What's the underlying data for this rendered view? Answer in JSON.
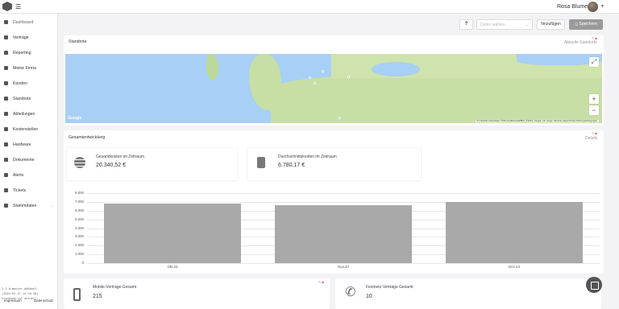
{
  "header": {
    "username": "Rosa Blume",
    "menu_icon": "hamburger-icon",
    "logo_icon": "app-logo"
  },
  "sidebar": {
    "items": [
      {
        "label": "Dashboard",
        "icon": "dashboard-icon"
      },
      {
        "label": "Verträge",
        "icon": "contract-icon"
      },
      {
        "label": "Reporting",
        "icon": "chart-icon"
      },
      {
        "label": "Meine Firma",
        "icon": "home-icon"
      },
      {
        "label": "Kunden",
        "icon": "customers-icon"
      },
      {
        "label": "Standorte",
        "icon": "location-icon"
      },
      {
        "label": "Abteilungen",
        "icon": "departments-icon"
      },
      {
        "label": "Kostenstellen",
        "icon": "cost-centers-icon"
      },
      {
        "label": "Hardware",
        "icon": "hardware-icon"
      },
      {
        "label": "Dokumente",
        "icon": "document-icon"
      },
      {
        "label": "Alerts",
        "icon": "alert-icon"
      },
      {
        "label": "Tickets",
        "icon": "ticket-icon"
      },
      {
        "label": "Stammdaten",
        "icon": "master-data-icon"
      }
    ],
    "version_lines": [
      "2.1.0-master-d66da4f",
      "(2024-02-21 14:34:30)",
      "Frontend ist aktuell"
    ],
    "footer_links": [
      "Impressum",
      "Datenschutz"
    ]
  },
  "toolbar": {
    "help_label": "?",
    "dropdown_placeholder": "Daten wählen",
    "add_label": "hinzufügen",
    "save_label": "⎐ Speichern"
  },
  "locations": {
    "title": "Standorte",
    "link": "Aktuelle Standorte",
    "map": {
      "provider": "Google",
      "attribution": "Kurzbefehle   Kartendaten ©2024 GeoBasis-DE/BKG (©2009), Google, Inst. Geogr. Nacional, Mapa GISrael   Nutzungsbedingungen",
      "zoom_in": "+",
      "zoom_out": "−",
      "fullscreen": "⤢"
    }
  },
  "trend": {
    "title": "Gesamtentwicklung",
    "link": "Details",
    "kpis": [
      {
        "label": "Gesamtkosten im Zeitraum",
        "value": "20.340,52 €",
        "icon": "coins-icon"
      },
      {
        "label": "Durchschnittskosten im Zeitraum",
        "value": "6.780,17 €",
        "icon": "average-icon"
      }
    ]
  },
  "chart_data": {
    "type": "bar",
    "categories": [
      "Okt.23",
      "Nov.23",
      "Dez.23"
    ],
    "values": [
      6800,
      6600,
      7000
    ],
    "ylim": [
      0,
      8000
    ],
    "yticks": [
      "0",
      "1.000",
      "2.000",
      "3.000",
      "4.000",
      "5.000",
      "6.000",
      "7.000",
      "8.000"
    ],
    "grid": true,
    "colors": {
      "bar": "#a9a9a9"
    }
  },
  "bottom_cards": [
    {
      "label": "Mobile-Verträge Gesamt",
      "value": "215",
      "icon": "mobile-phone-icon"
    },
    {
      "label": "Festnetz-Verträge Gesamt",
      "value": "10",
      "icon": "landline-phone-icon"
    }
  ],
  "fab_icon": "edit-icon"
}
